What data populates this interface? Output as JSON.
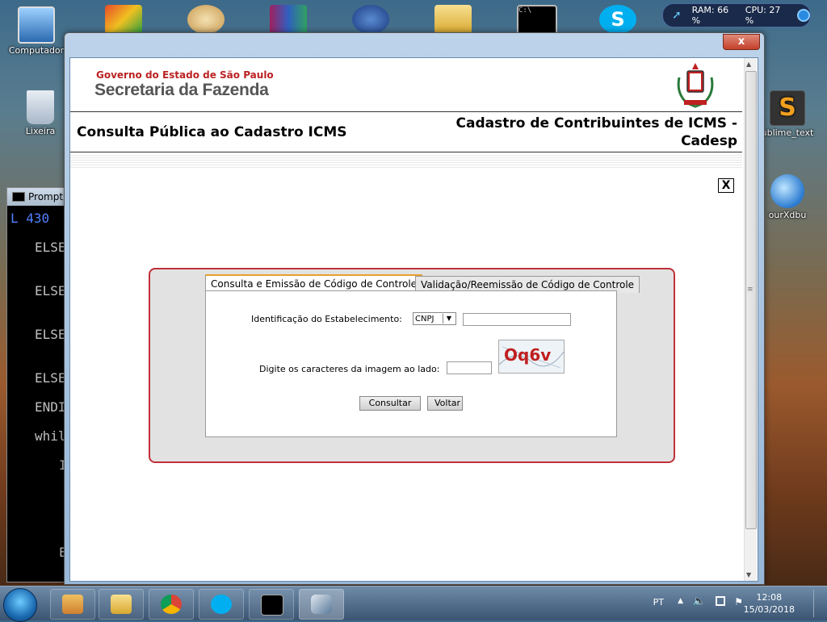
{
  "desktop": {
    "icons": [
      {
        "label": "Computador",
        "color": "#4a8ad0"
      },
      {
        "label": "Lixeira",
        "color": "#c8d4e0"
      },
      {
        "label": "ublime_text",
        "color": "#f0a020"
      },
      {
        "label": "ourXdbu",
        "color": "#3a8ae0"
      }
    ],
    "sysmon": {
      "ram": "RAM: 66 %",
      "cpu": "CPU: 27 %"
    }
  },
  "terminal": {
    "title": "Prompt",
    "lines": [
      "L 430",
      "ELSE",
      "ELSE",
      "ELSE",
      "ELSE",
      "ENDI",
      "whil",
      "I",
      "E"
    ]
  },
  "window": {
    "close_label": "x"
  },
  "page": {
    "gov_label": "Governo do Estado de São Paulo",
    "secretaria_label": "Secretaria da Fazenda",
    "title_left": "Consulta Pública ao Cadastro ICMS",
    "title_right_line1": "Cadastro de Contribuintes de ICMS -",
    "title_right_line2": "Cadesp",
    "close_x": "X"
  },
  "form": {
    "tabs": [
      {
        "label": "Consulta e Emissão de Código de Controle",
        "active": true
      },
      {
        "label": "Validação/Reemissão de Código de Controle",
        "active": false
      }
    ],
    "id_label": "Identificação do Estabelecimento:",
    "id_type_selected": "CNPJ",
    "id_value": "",
    "captcha_label": "Digite os caracteres da imagem ao lado:",
    "captcha_value": "",
    "captcha_text": "Oq6v",
    "btn_consultar": "Consultar",
    "btn_voltar": "Voltar"
  },
  "taskbar": {
    "lang": "PT",
    "time": "12:08",
    "date": "15/03/2018"
  },
  "colors": {
    "panel_border": "#c0303a",
    "tab_active_top": "#e8a030",
    "captcha_text": "#c02020"
  }
}
